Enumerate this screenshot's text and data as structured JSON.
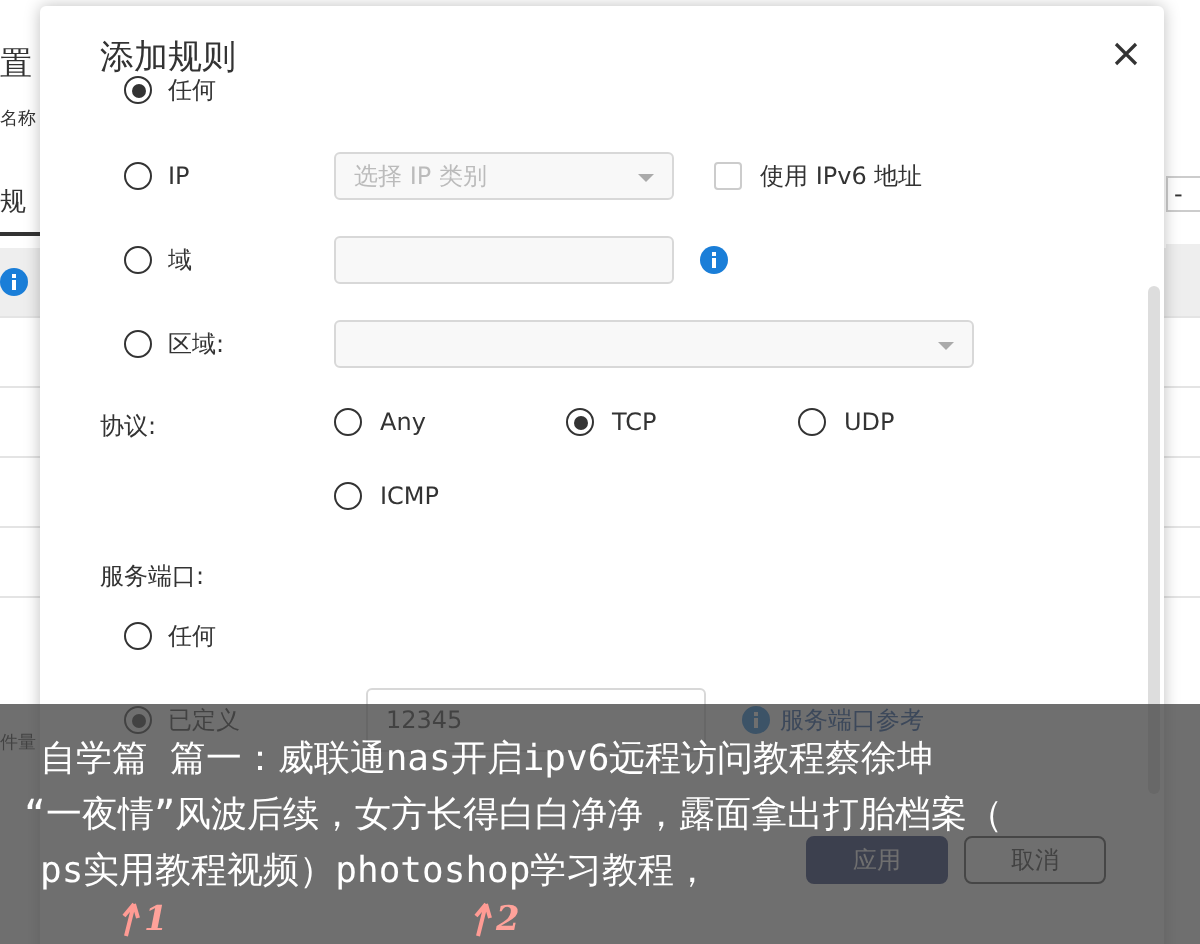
{
  "background_page": {
    "title": "置",
    "name_label": "名称",
    "tab": "规",
    "toolbar_button": "-",
    "row_text": "件量"
  },
  "dialog": {
    "title": "添加规则",
    "source_options": [
      {
        "kind": "plain",
        "label": "任何",
        "selected": true
      },
      {
        "kind": "select",
        "label": "IP",
        "selected": false,
        "placeholder": "选择 IP 类别",
        "checkbox": {
          "label": "使用 IPv6 地址",
          "checked": false
        }
      },
      {
        "kind": "input",
        "label": "域",
        "selected": false,
        "info": true
      },
      {
        "kind": "wide_select",
        "label": "区域:",
        "selected": false
      }
    ],
    "protocol": {
      "label": "协议:",
      "options": [
        {
          "label": "Any",
          "selected": false
        },
        {
          "label": "TCP",
          "selected": true
        },
        {
          "label": "UDP",
          "selected": false
        },
        {
          "label": "ICMP",
          "selected": false
        }
      ]
    },
    "service_port": {
      "label": "服务端口:",
      "options": [
        {
          "label": "任何",
          "selected": false
        },
        {
          "label": "已定义",
          "selected": true,
          "value": "12345",
          "link": "服务端口参考"
        }
      ]
    },
    "buttons": [
      {
        "label": "应用",
        "kind": "primary"
      },
      {
        "label": "取消",
        "kind": "secondary"
      }
    ]
  },
  "annotations": [
    {
      "label": "1"
    },
    {
      "label": "2"
    }
  ],
  "caption": {
    "lines": [
      "自学篇 篇一：威联通nas开启ipv6远程访问教程蔡徐坤",
      "“一夜情”风波后续，女方长得白白净净，露面拿出打胎档案（",
      "ps实用教程视频）photoshop学习教程，"
    ]
  }
}
